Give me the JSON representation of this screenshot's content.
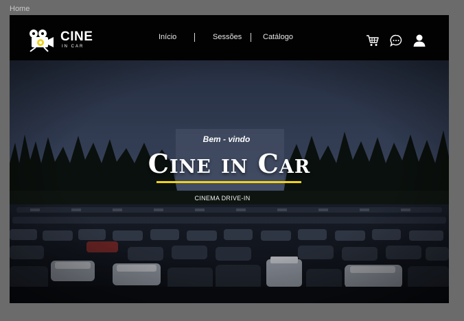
{
  "frame": {
    "label": "Home"
  },
  "brand": {
    "title": "CINE",
    "subtitle": "IN CAR"
  },
  "nav": {
    "links": [
      "Início",
      "Sessões",
      "Catálogo"
    ]
  },
  "icons": [
    "cart-icon",
    "chat-icon",
    "user-icon"
  ],
  "hero": {
    "welcome": "Bem - vindo",
    "title": "Cine in Car",
    "subtitle": "CINEMA DRIVE-IN"
  },
  "colors": {
    "accent": "#f0d219",
    "navbar": "#020202",
    "logo_accent": "#f0d219"
  }
}
